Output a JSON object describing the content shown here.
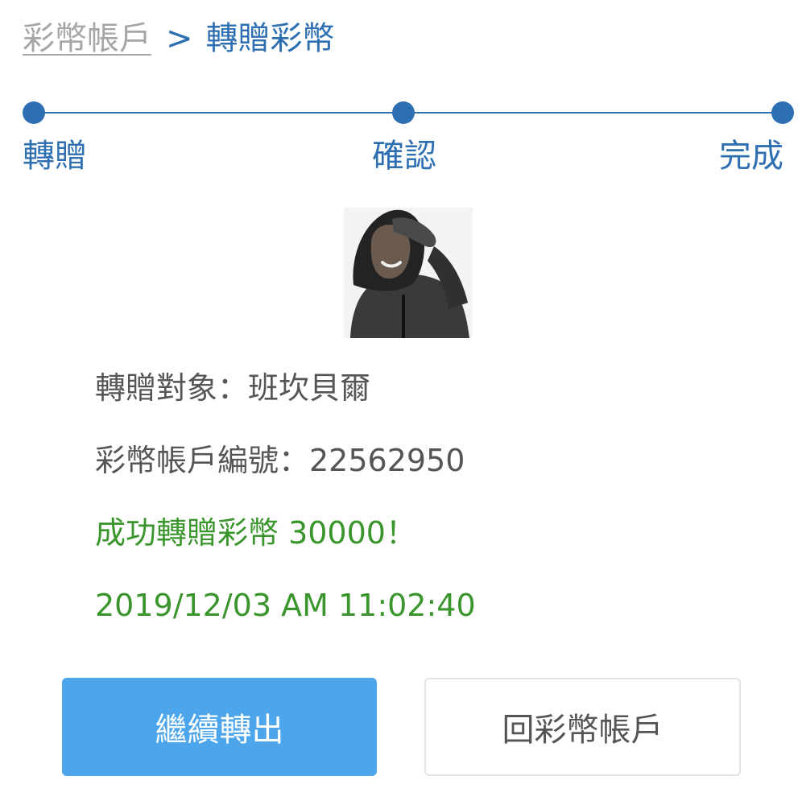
{
  "breadcrumb": {
    "parent": "彩幣帳戶",
    "separator": ">",
    "current": "轉贈彩幣"
  },
  "steps": [
    {
      "label": "轉贈"
    },
    {
      "label": "確認"
    },
    {
      "label": "完成"
    }
  ],
  "recipient": {
    "name_line": "轉贈對象：班坎貝爾",
    "account_line": "彩幣帳戶編號：22562950"
  },
  "result": {
    "message": "成功轉贈彩幣 30000！",
    "timestamp": "2019/12/03 AM 11:02:40"
  },
  "actions": {
    "continue_label": "繼續轉出",
    "back_label": "回彩幣帳戶"
  },
  "colors": {
    "accent": "#2d6fb0",
    "success": "#3a962c",
    "primary_button": "#4da6ec",
    "muted_text": "#555555"
  }
}
